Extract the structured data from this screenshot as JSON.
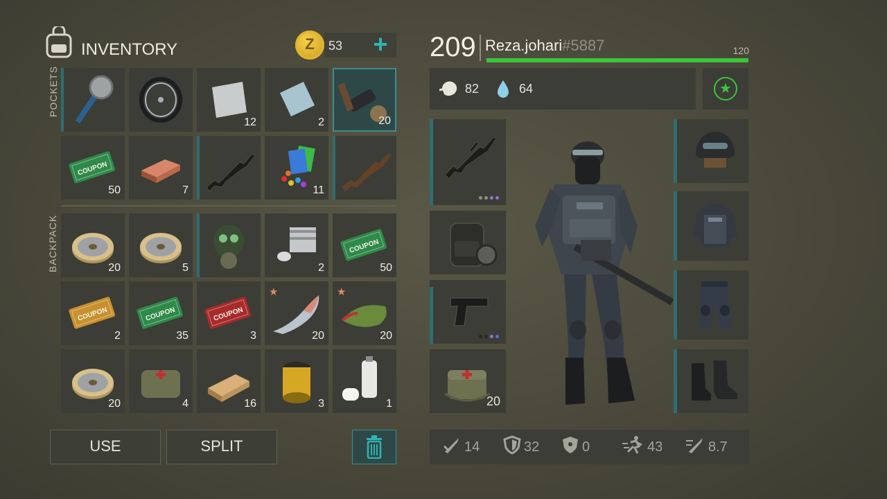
{
  "inventory": {
    "title": "INVENTORY",
    "coins": "53",
    "pockets_label": "POCKETS",
    "backpack_label": "BACKPACK",
    "pockets": [
      {
        "name": "saw-mace-icon",
        "count": "",
        "dots": [
          1,
          0,
          0,
          0,
          0
        ],
        "bar": true
      },
      {
        "name": "wheel-icon",
        "count": ""
      },
      {
        "name": "metal-plate-icon",
        "count": "12"
      },
      {
        "name": "steel-plate-icon",
        "count": "2"
      },
      {
        "name": "parts-icon",
        "count": "20",
        "selected": true
      },
      {
        "name": "ration-coupon-icon",
        "count": "50"
      },
      {
        "name": "copper-ingot-icon",
        "count": "7"
      },
      {
        "name": "m16-rifle-icon",
        "count": "",
        "bar": true
      },
      {
        "name": "dye-kit-icon",
        "count": "11"
      },
      {
        "name": "ak47-rifle-icon",
        "count": "",
        "bar": true
      }
    ],
    "backpack": [
      {
        "name": "wire-spool-icon",
        "count": "20"
      },
      {
        "name": "wire-spool-icon",
        "count": "5"
      },
      {
        "name": "gas-mask-icon",
        "count": "",
        "bar": true
      },
      {
        "name": "engine-block-icon",
        "count": "2"
      },
      {
        "name": "ration-coupon-icon",
        "count": "50"
      },
      {
        "name": "survival-kit-coupon-icon",
        "count": "2"
      },
      {
        "name": "ration-coupon-icon",
        "count": "35"
      },
      {
        "name": "combat-gear-coupon-icon",
        "count": "3"
      },
      {
        "name": "salmon-icon",
        "count": "20",
        "star": true
      },
      {
        "name": "pike-fish-icon",
        "count": "20",
        "star": true
      },
      {
        "name": "wire-spool-icon",
        "count": "20"
      },
      {
        "name": "first-aid-bag-icon",
        "count": "4"
      },
      {
        "name": "wood-plank-icon",
        "count": "16"
      },
      {
        "name": "oil-filter-icon",
        "count": "3"
      },
      {
        "name": "paint-can-icon",
        "count": "1"
      }
    ],
    "buttons": {
      "use": "USE",
      "split": "SPLIT"
    }
  },
  "player": {
    "level": "209",
    "name": "Reza.johari",
    "tag": "#5887",
    "xp_max": "120",
    "xp_fraction": 1.0,
    "hunger": "82",
    "thirst": "64",
    "medkit_count": "20"
  },
  "stats": [
    {
      "icon": "melee-damage-icon",
      "value": "14"
    },
    {
      "icon": "armor-shield-icon",
      "value": "32"
    },
    {
      "icon": "radiation-shield-icon",
      "value": "0"
    },
    {
      "icon": "speed-icon",
      "value": "43"
    },
    {
      "icon": "attack-speed-icon",
      "value": "8.7"
    }
  ],
  "colors": {
    "accent": "#2fb4b4",
    "xp_bar": "#3cc63c",
    "bar": "#2f6d72"
  }
}
